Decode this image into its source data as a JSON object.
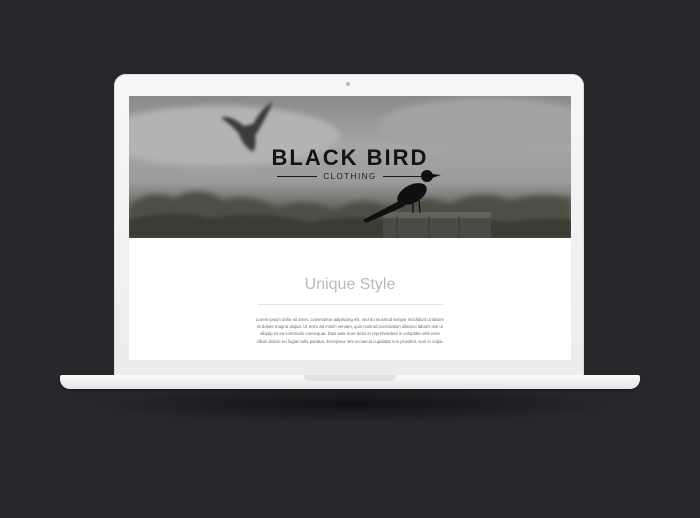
{
  "hero": {
    "brand_title": "BLACK BIRD",
    "brand_subtitle": "CLOTHING"
  },
  "section": {
    "title": "Unique Style",
    "body": "Lorem ipsum dolor sit amet, consectetur adipiscing elit, sed do eiusmod tempor incididunt ut labore et dolore magna aliqua. Ut enim ad minim veniam, quis nostrud exercitation ullamco laboris nisi ut aliquip ex ea commodo consequat. Duis aute irure dolor in reprehenderit in voluptate velit esse cillum dolore eu fugiat nulla pariatur. Excepteur sint occaecat cupidatat non proident, sunt in culpa."
  },
  "colors": {
    "backdrop": "#26282c",
    "laptop_body": "#f2f2f2",
    "brand_text": "#141414",
    "section_title": "#b9b9b9"
  }
}
